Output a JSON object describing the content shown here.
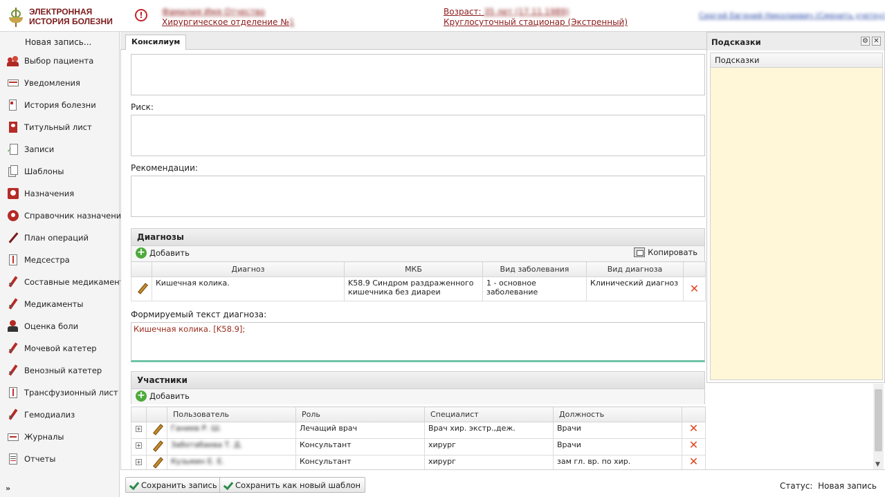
{
  "header": {
    "logo_line1": "ЭЛЕКТРОННАЯ",
    "logo_line2": "ИСТОРИЯ БОЛЕЗНИ",
    "alert_symbol": "!",
    "patient_name": "Фамилия Имя Отчество",
    "department": "Хирургическое отделение №",
    "department_number": "1",
    "age_label": "Возраст:",
    "age_value": "35 лет (17.11.1989)",
    "stay_type": "Круглосуточный стационар (Экстренный)",
    "user": "Сергей Евгений Николаевич (Сменить учетку)"
  },
  "nav": {
    "new_record": "Новая запись...",
    "expand": "»",
    "items": [
      {
        "label": "Выбор пациента",
        "icon": "patients-icon"
      },
      {
        "label": "Уведомления",
        "icon": "envelope-icon"
      },
      {
        "label": "История болезни",
        "icon": "history-icon"
      },
      {
        "label": "Титульный лист",
        "icon": "title-page-icon"
      },
      {
        "label": "Записи",
        "icon": "records-icon"
      },
      {
        "label": "Шаблоны",
        "icon": "templates-icon"
      },
      {
        "label": "Назначения",
        "icon": "prescriptions-icon"
      },
      {
        "label": "Справочник назначений",
        "icon": "directory-icon"
      },
      {
        "label": "План операций",
        "icon": "scalpel-icon"
      },
      {
        "label": "Медсестра",
        "icon": "thermometer-icon"
      },
      {
        "label": "Составные медикаменты",
        "icon": "syringe-icon"
      },
      {
        "label": "Медикаменты",
        "icon": "syringe-icon"
      },
      {
        "label": "Оценка боли",
        "icon": "pain-icon"
      },
      {
        "label": "Мочевой катетер",
        "icon": "syringe-icon"
      },
      {
        "label": "Венозный катетер",
        "icon": "syringe-icon"
      },
      {
        "label": "Трансфузионный лист",
        "icon": "thermometer-icon"
      },
      {
        "label": "Гемодиализ",
        "icon": "syringe-icon"
      },
      {
        "label": "Журналы",
        "icon": "journal-icon"
      },
      {
        "label": "Отчеты",
        "icon": "report-icon"
      }
    ]
  },
  "tab": {
    "label": "Консилиум"
  },
  "form": {
    "risk_label": "Риск:",
    "recommendations_label": "Рекомендации:"
  },
  "diagnoses": {
    "title": "Диагнозы",
    "add_label": "Добавить",
    "copy_label": "Копировать",
    "columns": [
      "Диагноз",
      "МКБ",
      "Вид заболевания",
      "Вид диагноза"
    ],
    "rows": [
      {
        "diagnosis": "Кишечная колика.",
        "mkb": "K58.9 Синдром раздраженного кишечника без диареи",
        "disease_type": "1 - основное заболевание",
        "diagnosis_type": "Клинический диагноз"
      }
    ],
    "formed_text_label": "Формируемый текст диагноза:",
    "formed_text": "Кишечная колика. [K58.9];"
  },
  "participants": {
    "title": "Участники",
    "add_label": "Добавить",
    "columns": [
      "Пользователь",
      "Роль",
      "Специалист",
      "Должность"
    ],
    "rows": [
      {
        "user": "Ганиев Р. Ш.",
        "role": "Лечащий врач",
        "specialist": "Врач хир. экстр.,деж.",
        "position": "Врачи"
      },
      {
        "user": "Заботабаева Т. Д.",
        "role": "Консультант",
        "specialist": "хирург",
        "position": "Врачи"
      },
      {
        "user": "Кузьмин Е. Е.",
        "role": "Консультант",
        "specialist": "хирург",
        "position": "зам гл. вр. по хир."
      }
    ]
  },
  "hints": {
    "title": "Подсказки",
    "subheader": "Подсказки",
    "background": "#fff7d8"
  },
  "footer": {
    "save_label": "Сохранить запись",
    "save_template_label": "Сохранить как новый шаблон",
    "status_label": "Статус:",
    "status_value": "Новая запись"
  },
  "colors": {
    "accent_link": "#8b1a1a",
    "delete": "#e0451f",
    "add": "#4caa3a",
    "diagnosis_text": "#9a2a1a",
    "underline_bar": "#6fc3a6"
  }
}
